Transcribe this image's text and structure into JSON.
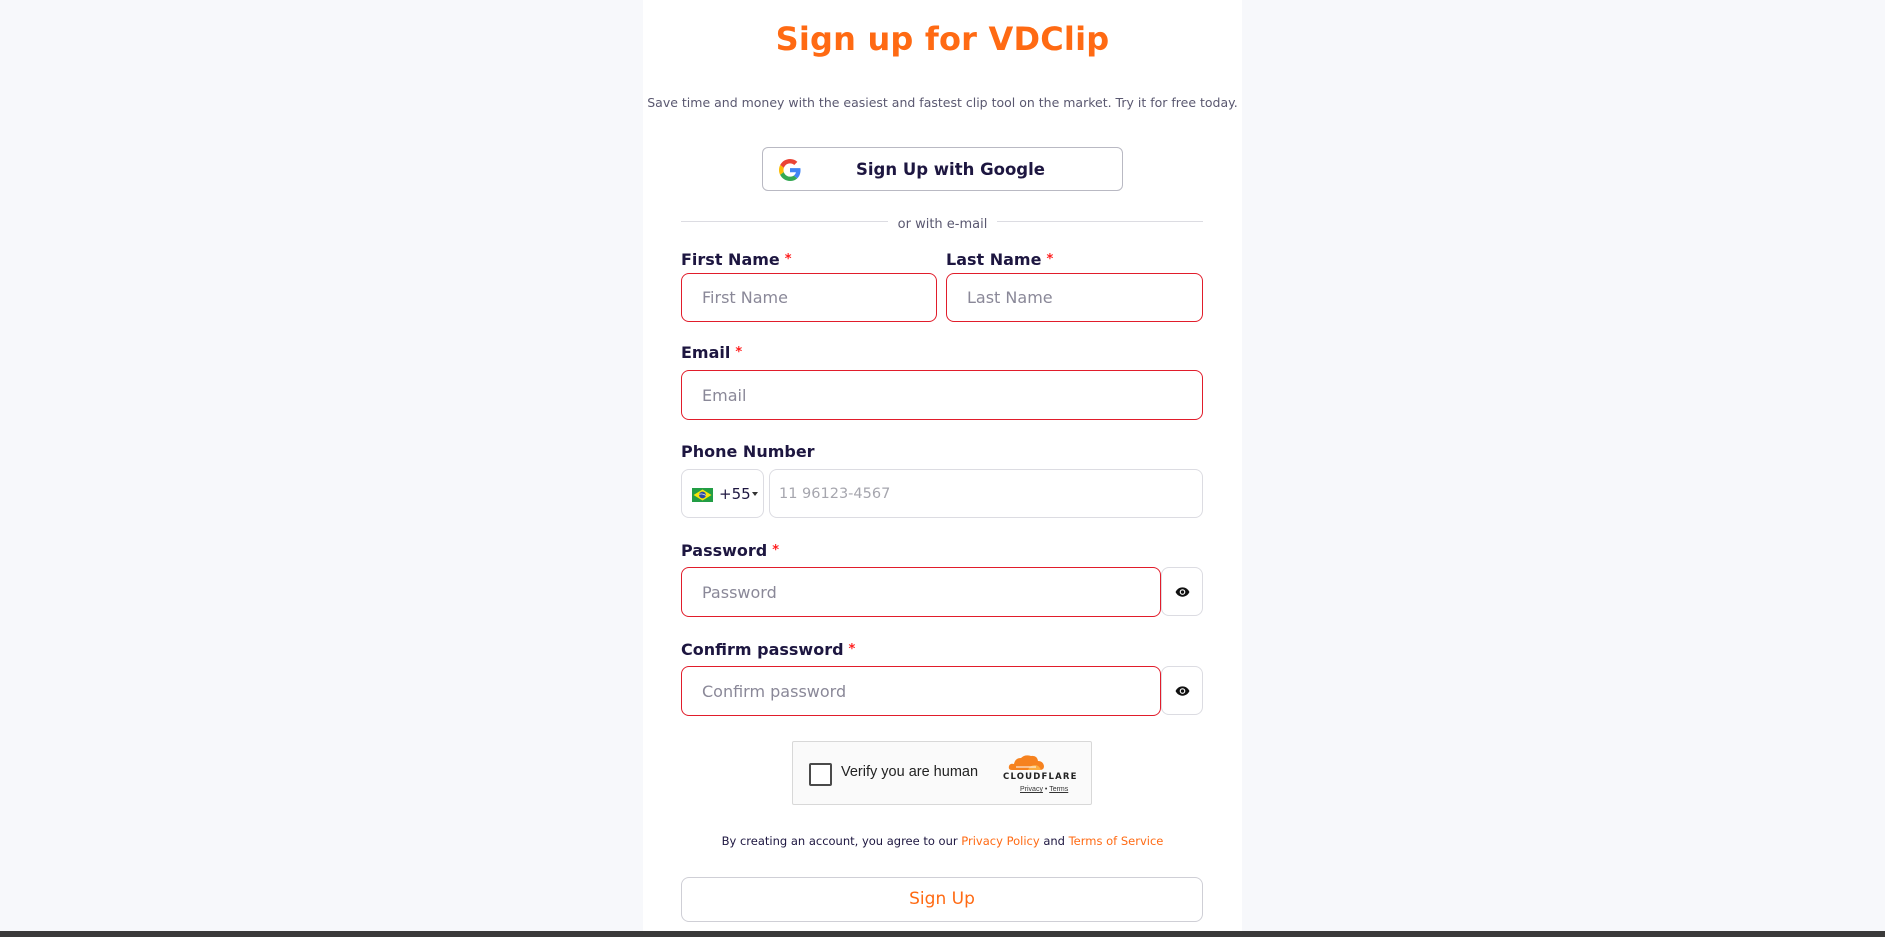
{
  "header": {
    "title": "Sign up for VDClip",
    "subtitle": "Save time and money with the easiest and fastest clip tool on the market. Try it for free today."
  },
  "google": {
    "label": "Sign Up with Google",
    "icon": "google-g-icon"
  },
  "divider_text": "or with e-mail",
  "fields": {
    "first_name": {
      "label": "First Name",
      "required_mark": "*",
      "placeholder": "First Name"
    },
    "last_name": {
      "label": "Last Name",
      "required_mark": "*",
      "placeholder": "Last Name"
    },
    "email": {
      "label": "Email",
      "required_mark": "*",
      "placeholder": "Email"
    },
    "phone": {
      "label": "Phone Number",
      "country_code": "+55",
      "flag": "brazil-flag-icon",
      "placeholder": "11 96123-4567"
    },
    "password": {
      "label": "Password",
      "required_mark": "*",
      "placeholder": "Password",
      "toggle_icon": "eye-icon"
    },
    "confirm_password": {
      "label": "Confirm password",
      "required_mark": "*",
      "placeholder": "Confirm password",
      "toggle_icon": "eye-icon"
    }
  },
  "captcha": {
    "label": "Verify you are human",
    "brand": "CLOUDFLARE",
    "privacy": "Privacy",
    "separator": "•",
    "terms": "Terms"
  },
  "agreement": {
    "prefix": "By creating an account, you agree to our",
    "privacy_link": "Privacy Policy",
    "conjunction": "and",
    "terms_link": "Terms of Service"
  },
  "submit": {
    "label": "Sign Up"
  },
  "colors": {
    "accent": "#ff6a13",
    "error_border": "#e11d2b",
    "required": "#ff1f1f",
    "text": "#1d1640"
  }
}
